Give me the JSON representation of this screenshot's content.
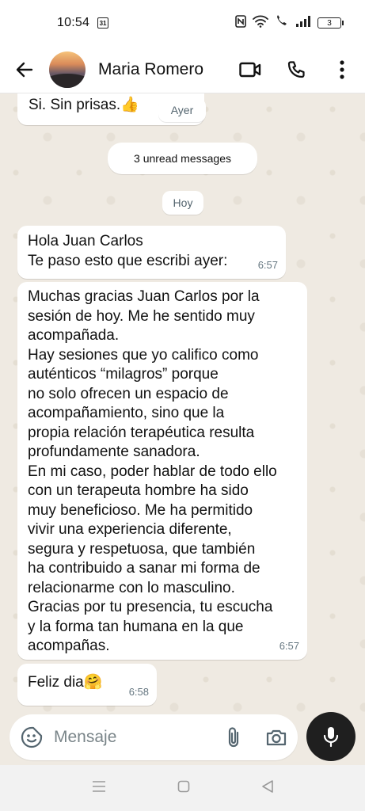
{
  "status": {
    "time": "10:54",
    "calendar_day": "31",
    "battery": "3"
  },
  "header": {
    "contact_name": "Maria Romero"
  },
  "chat": {
    "prev_message": {
      "text": "Si. Sin prisas.👍"
    },
    "prev_day_label": "Ayer",
    "unread_label": "3 unread messages",
    "today_label": "Hoy",
    "messages": [
      {
        "text": "Hola Juan Carlos\nTe paso esto que escribi ayer:",
        "time": "6:57"
      },
      {
        "text": "Muchas gracias Juan Carlos por la\nsesión de hoy. Me he sentido muy\nacompañada.\nHay sesiones que yo califico como\nauténticos “milagros” porque\nno solo ofrecen un espacio de\nacompañamiento, sino que la\npropia relación terapéutica resulta\nprofundamente sanadora.\nEn mi caso, poder hablar de todo ello\ncon un terapeuta hombre ha sido\nmuy beneficioso. Me ha permitido\nvivir una experiencia diferente,\nsegura y respetuosa, que también\nha contribuido a sanar mi forma de\nrelacionarme con lo masculino.\nGracias por tu presencia, tu escucha\ny la forma tan humana en la que\nacompañas.",
        "time": "6:57"
      },
      {
        "text": "Feliz dia🤗",
        "time": "6:58"
      }
    ]
  },
  "composer": {
    "placeholder": "Mensaje"
  },
  "colors": {
    "background": "#efeae2",
    "bubble": "#ffffff",
    "mic": "#1f1f1f",
    "timestamp": "#667781"
  }
}
